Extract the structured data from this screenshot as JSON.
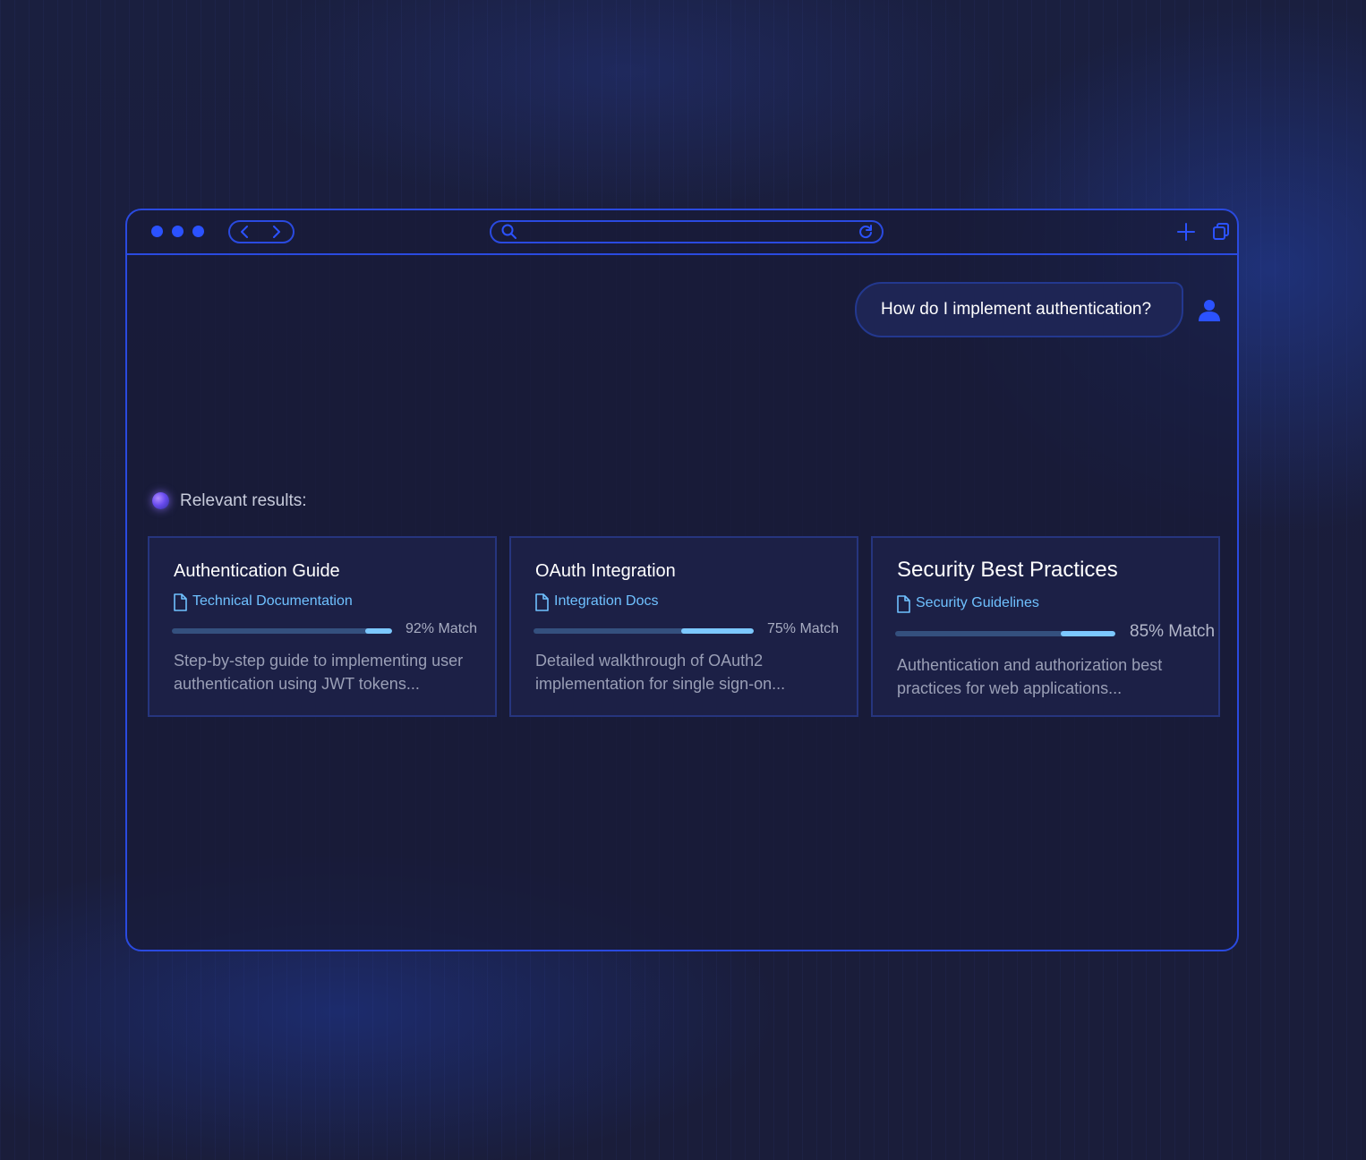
{
  "query": {
    "text": "How do I implement authentication?"
  },
  "results": {
    "header": "Relevant results:",
    "cards": [
      {
        "title": "Authentication Guide",
        "source": "Technical Documentation",
        "match_label": "92% Match",
        "match_fill": 0.12,
        "description": "Step-by-step guide to implementing user authentication using JWT tokens..."
      },
      {
        "title": "OAuth Integration",
        "source": "Integration Docs",
        "match_label": "75% Match",
        "match_fill": 0.33,
        "description": "Detailed walkthrough of OAuth2 implementation for single sign-on..."
      },
      {
        "title": "Security Best Practices",
        "source": "Security Guidelines",
        "match_label": "85% Match",
        "match_fill": 0.25,
        "description": "Authentication and authorization best practices for web applications..."
      }
    ]
  },
  "icons": {
    "window_controls": [
      "dot-icon",
      "dot-icon",
      "dot-icon"
    ],
    "nav": [
      "chevron-left-icon",
      "chevron-right-icon"
    ],
    "urlbar": [
      "search-icon",
      "refresh-icon"
    ],
    "toolbar_right": [
      "plus-icon",
      "copy-icon"
    ],
    "user": "user-icon",
    "source": "document-icon"
  },
  "colors": {
    "accent": "#2b52ff",
    "border": "#2a4ae0",
    "link": "#6fc1ff",
    "progress_fill": "#7cc8ff",
    "progress_track": "#34507e"
  }
}
